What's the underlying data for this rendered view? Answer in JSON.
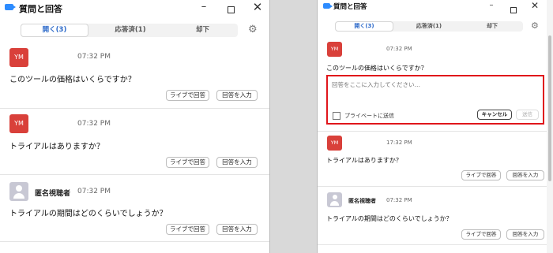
{
  "window": {
    "title": "質問と回答",
    "minimize_icon": "minimize-icon",
    "maximize_icon": "maximize-icon",
    "close_icon": "close-icon"
  },
  "tabs": [
    {
      "label": "開く(3)",
      "active": true
    },
    {
      "label": "応答済(1)",
      "active": false
    },
    {
      "label": "却下",
      "active": false
    }
  ],
  "settings_icon": "gear-icon",
  "questions": [
    {
      "avatar": "YM",
      "name": "",
      "time": "07:32 PM",
      "text": "このツールの価格はいくらですか？"
    },
    {
      "avatar": "YM",
      "name": "",
      "time": "07:32 PM",
      "text": "トライアルはありますか？"
    },
    {
      "avatar": "",
      "name": "匿名視聴者",
      "time": "07:32 PM",
      "text": "トライアルの期間はどのくらいでしょうか？"
    }
  ],
  "actions": {
    "live_answer": "ライブで回答",
    "type_answer": "回答を入力"
  },
  "answer_box": {
    "placeholder": "回答をここに入力してください…",
    "private_label": "プライベートに送信",
    "private_checked": false,
    "cancel": "キャンセル",
    "send": "送信"
  },
  "right_times": [
    "07:32 PM",
    "17:32 PM",
    "07:32 PM"
  ],
  "colors": {
    "accent": "#2d6ac9",
    "avatar": "#d9403a",
    "highlight": "#e0151b"
  }
}
